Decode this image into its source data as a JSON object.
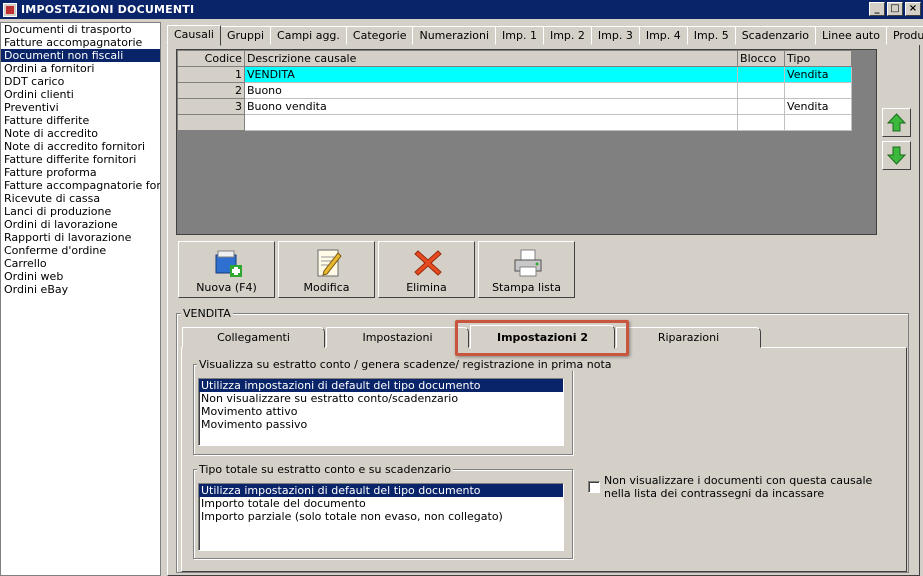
{
  "window": {
    "title": "IMPOSTAZIONI DOCUMENTI",
    "buttons": [
      "_",
      "□",
      "×"
    ]
  },
  "sidebar": {
    "items": [
      "Documenti di trasporto",
      "Fatture accompagnatorie",
      "Documenti non fiscali",
      "Ordini a fornitori",
      "DDT carico",
      "Ordini clienti",
      "Preventivi",
      "Fatture differite",
      "Note di accredito",
      "Note di accredito fornitori",
      "Fatture differite fornitori",
      "Fatture proforma",
      "Fatture accompagnatorie fornito",
      "Ricevute di cassa",
      "Lanci di produzione",
      "Ordini di lavorazione",
      "Rapporti di lavorazione",
      "Conferme d'ordine",
      "Carrello",
      "Ordini web",
      "Ordini eBay"
    ],
    "selected_index": 2
  },
  "tabs": [
    "Causali",
    "Gruppi",
    "Campi agg.",
    "Categorie",
    "Numerazioni",
    "Imp. 1",
    "Imp. 2",
    "Imp. 3",
    "Imp. 4",
    "Imp. 5",
    "Scadenzario",
    "Linee auto",
    "Produzione"
  ],
  "active_tab": "Causali",
  "grid": {
    "headers": {
      "code": "Codice",
      "desc": "Descrizione causale",
      "block": "Blocco",
      "type": "Tipo"
    },
    "rows": [
      {
        "code": "1",
        "desc": "VENDITA",
        "block": "",
        "type": "Vendita"
      },
      {
        "code": "2",
        "desc": "Buono",
        "block": "",
        "type": ""
      },
      {
        "code": "3",
        "desc": "Buono vendita",
        "block": "",
        "type": "Vendita"
      },
      {
        "code": "",
        "desc": "",
        "block": "",
        "type": ""
      }
    ],
    "selected_row": 0,
    "colors": {
      "selection": "#00ffff"
    }
  },
  "toolbar": {
    "new_label": "Nuova (F4)",
    "edit_label": "Modifica",
    "delete_label": "Elimina",
    "print_label": "Stampa lista"
  },
  "detail": {
    "group_label": "VENDITA",
    "tabs": [
      "Collegamenti",
      "Impostazioni",
      "Impostazioni 2",
      "Riparazioni"
    ],
    "active_tab": "Impostazioni 2",
    "highlight_color": "#c8553d",
    "section1": {
      "label": "Visualizza su estratto conto / genera scadenze/ registrazione  in prima nota",
      "options": [
        "Utilizza impostazioni di default del tipo documento",
        "Non visualizzare su estratto conto/scadenzario",
        "Movimento attivo",
        "Movimento passivo"
      ],
      "selected_index": 0
    },
    "section2": {
      "label": "Tipo totale su estratto conto e su scadenzario",
      "options": [
        "Utilizza impostazioni di default del tipo documento",
        "Importo totale del documento",
        "Importo parziale (solo totale non evaso, non collegato)"
      ],
      "selected_index": 0
    },
    "checkbox_label": "Non visualizzare i documenti con questa causale nella lista dei contrassegni da incassare",
    "checkbox_checked": false
  }
}
